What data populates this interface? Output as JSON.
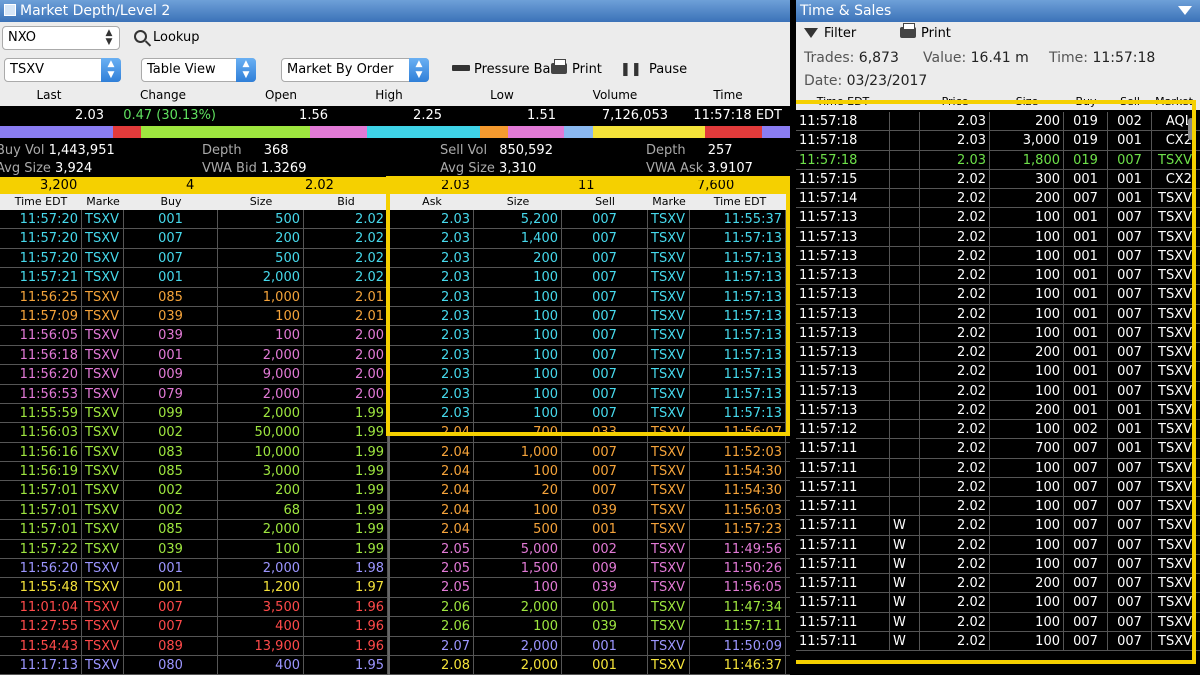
{
  "left_window": {
    "title": "Market Depth/Level 2",
    "symbol_value": "NXO",
    "lookup_label": "Lookup",
    "exchange_value": "TSXV",
    "view_value": "Table View",
    "mode_value": "Market By Order",
    "pressure_bar_label": "Pressure Bar",
    "print_label": "Print",
    "pause_label": "Pause"
  },
  "quote": {
    "headers": [
      "Last",
      "Change",
      "Open",
      "High",
      "Low",
      "Volume",
      "Time"
    ],
    "last": "2.03",
    "change": "0.47 (30.13%)",
    "open": "1.56",
    "high": "2.25",
    "low": "1.51",
    "volume": "7,126,053",
    "time": "11:57:18 EDT"
  },
  "color_strip": [
    "#8a7df2",
    "#8a7df2",
    "#8a7df2",
    "#8a7df2",
    "#e23b3b",
    "#9ee63f",
    "#9ee63f",
    "#9ee63f",
    "#9ee63f",
    "#9ee63f",
    "#9ee63f",
    "#e27ad6",
    "#e27ad6",
    "#3fd3e8",
    "#3fd3e8",
    "#3fd3e8",
    "#3fd3e8",
    "#f59a2f",
    "#e27ad6",
    "#e27ad6",
    "#8ab8f0",
    "#f5e33a",
    "#f5e33a",
    "#f5e33a",
    "#f5e33a",
    "#e23b3b",
    "#e23b3b",
    "#8a7df2"
  ],
  "stats": {
    "buy_vol_label": "Buy Vol",
    "buy_vol": "1,443,951",
    "avg_size_label": "Avg Size",
    "avg_size_bid": "3,924",
    "depth_label": "Depth",
    "depth_bid": "368",
    "vwa_bid_label": "VWA Bid",
    "vwa_bid": "1.3269",
    "sell_vol_label": "Sell Vol",
    "sell_vol": "850,592",
    "avg_size_ask": "3,310",
    "depth_ask": "257",
    "vwa_ask_label": "VWA Ask",
    "vwa_ask": "3.9107"
  },
  "summary": {
    "bid_size": "3,200",
    "bid_count": "4",
    "bid_price": "2.02",
    "ask_price": "2.03",
    "ask_count": "11",
    "ask_size": "7,600"
  },
  "bid_headers": [
    "Time EDT",
    "Marke",
    "Buy",
    "Size",
    "Bid"
  ],
  "ask_headers": [
    "Ask",
    "Size",
    "Sell",
    "Marke",
    "Time EDT"
  ],
  "bids": [
    {
      "time": "11:57:20",
      "mkt": "TSXV",
      "broker": "001",
      "size": "500",
      "price": "2.02",
      "color": "#46d9ec"
    },
    {
      "time": "11:57:20",
      "mkt": "TSXV",
      "broker": "007",
      "size": "200",
      "price": "2.02",
      "color": "#46d9ec"
    },
    {
      "time": "11:57:20",
      "mkt": "TSXV",
      "broker": "007",
      "size": "500",
      "price": "2.02",
      "color": "#46d9ec"
    },
    {
      "time": "11:57:21",
      "mkt": "TSXV",
      "broker": "001",
      "size": "2,000",
      "price": "2.02",
      "color": "#46d9ec"
    },
    {
      "time": "11:56:25",
      "mkt": "TSXV",
      "broker": "085",
      "size": "1,000",
      "price": "2.01",
      "color": "#f5a33a"
    },
    {
      "time": "11:57:09",
      "mkt": "TSXV",
      "broker": "039",
      "size": "100",
      "price": "2.01",
      "color": "#f5a33a"
    },
    {
      "time": "11:56:05",
      "mkt": "TSXV",
      "broker": "039",
      "size": "100",
      "price": "2.00",
      "color": "#e27ad6"
    },
    {
      "time": "11:56:18",
      "mkt": "TSXV",
      "broker": "001",
      "size": "2,000",
      "price": "2.00",
      "color": "#e27ad6"
    },
    {
      "time": "11:56:20",
      "mkt": "TSXV",
      "broker": "009",
      "size": "9,000",
      "price": "2.00",
      "color": "#e27ad6"
    },
    {
      "time": "11:56:53",
      "mkt": "TSXV",
      "broker": "079",
      "size": "2,000",
      "price": "2.00",
      "color": "#e27ad6"
    },
    {
      "time": "11:55:59",
      "mkt": "TSXV",
      "broker": "099",
      "size": "2,000",
      "price": "1.99",
      "color": "#9ee63f"
    },
    {
      "time": "11:56:03",
      "mkt": "TSXV",
      "broker": "002",
      "size": "50,000",
      "price": "1.99",
      "color": "#9ee63f"
    },
    {
      "time": "11:56:16",
      "mkt": "TSXV",
      "broker": "083",
      "size": "10,000",
      "price": "1.99",
      "color": "#9ee63f"
    },
    {
      "time": "11:56:19",
      "mkt": "TSXV",
      "broker": "085",
      "size": "3,000",
      "price": "1.99",
      "color": "#9ee63f"
    },
    {
      "time": "11:57:01",
      "mkt": "TSXV",
      "broker": "002",
      "size": "200",
      "price": "1.99",
      "color": "#9ee63f"
    },
    {
      "time": "11:57:01",
      "mkt": "TSXV",
      "broker": "002",
      "size": "68",
      "price": "1.99",
      "color": "#9ee63f"
    },
    {
      "time": "11:57:01",
      "mkt": "TSXV",
      "broker": "085",
      "size": "2,000",
      "price": "1.99",
      "color": "#9ee63f"
    },
    {
      "time": "11:57:22",
      "mkt": "TSXV",
      "broker": "039",
      "size": "100",
      "price": "1.99",
      "color": "#9ee63f"
    },
    {
      "time": "11:56:20",
      "mkt": "TSXV",
      "broker": "001",
      "size": "2,000",
      "price": "1.98",
      "color": "#9c96ff"
    },
    {
      "time": "11:55:48",
      "mkt": "TSXV",
      "broker": "001",
      "size": "1,200",
      "price": "1.97",
      "color": "#f5e33a"
    },
    {
      "time": "11:01:04",
      "mkt": "TSXV",
      "broker": "007",
      "size": "3,500",
      "price": "1.96",
      "color": "#ff4a4a"
    },
    {
      "time": "11:27:55",
      "mkt": "TSXV",
      "broker": "007",
      "size": "400",
      "price": "1.96",
      "color": "#ff4a4a"
    },
    {
      "time": "11:54:43",
      "mkt": "TSXV",
      "broker": "089",
      "size": "13,900",
      "price": "1.96",
      "color": "#ff4a4a"
    },
    {
      "time": "11:17:13",
      "mkt": "TSXV",
      "broker": "080",
      "size": "400",
      "price": "1.95",
      "color": "#9c96ff"
    }
  ],
  "asks": [
    {
      "price": "2.03",
      "size": "5,200",
      "broker": "007",
      "mkt": "TSXV",
      "time": "11:55:37",
      "color": "#46d9ec"
    },
    {
      "price": "2.03",
      "size": "1,400",
      "broker": "007",
      "mkt": "TSXV",
      "time": "11:57:13",
      "color": "#46d9ec"
    },
    {
      "price": "2.03",
      "size": "200",
      "broker": "007",
      "mkt": "TSXV",
      "time": "11:57:13",
      "color": "#46d9ec"
    },
    {
      "price": "2.03",
      "size": "100",
      "broker": "007",
      "mkt": "TSXV",
      "time": "11:57:13",
      "color": "#46d9ec"
    },
    {
      "price": "2.03",
      "size": "100",
      "broker": "007",
      "mkt": "TSXV",
      "time": "11:57:13",
      "color": "#46d9ec"
    },
    {
      "price": "2.03",
      "size": "100",
      "broker": "007",
      "mkt": "TSXV",
      "time": "11:57:13",
      "color": "#46d9ec"
    },
    {
      "price": "2.03",
      "size": "100",
      "broker": "007",
      "mkt": "TSXV",
      "time": "11:57:13",
      "color": "#46d9ec"
    },
    {
      "price": "2.03",
      "size": "100",
      "broker": "007",
      "mkt": "TSXV",
      "time": "11:57:13",
      "color": "#46d9ec"
    },
    {
      "price": "2.03",
      "size": "100",
      "broker": "007",
      "mkt": "TSXV",
      "time": "11:57:13",
      "color": "#46d9ec"
    },
    {
      "price": "2.03",
      "size": "100",
      "broker": "007",
      "mkt": "TSXV",
      "time": "11:57:13",
      "color": "#46d9ec"
    },
    {
      "price": "2.03",
      "size": "100",
      "broker": "007",
      "mkt": "TSXV",
      "time": "11:57:13",
      "color": "#46d9ec"
    },
    {
      "price": "2.04",
      "size": "700",
      "broker": "033",
      "mkt": "TSXV",
      "time": "11:56:07",
      "color": "#f5a33a"
    },
    {
      "price": "2.04",
      "size": "1,000",
      "broker": "007",
      "mkt": "TSXV",
      "time": "11:52:03",
      "color": "#f5a33a"
    },
    {
      "price": "2.04",
      "size": "100",
      "broker": "007",
      "mkt": "TSXV",
      "time": "11:54:30",
      "color": "#f5a33a"
    },
    {
      "price": "2.04",
      "size": "20",
      "broker": "007",
      "mkt": "TSXV",
      "time": "11:54:30",
      "color": "#f5a33a"
    },
    {
      "price": "2.04",
      "size": "100",
      "broker": "039",
      "mkt": "TSXV",
      "time": "11:56:03",
      "color": "#f5a33a"
    },
    {
      "price": "2.04",
      "size": "500",
      "broker": "001",
      "mkt": "TSXV",
      "time": "11:57:23",
      "color": "#f5a33a"
    },
    {
      "price": "2.05",
      "size": "5,000",
      "broker": "002",
      "mkt": "TSXV",
      "time": "11:49:56",
      "color": "#e27ad6"
    },
    {
      "price": "2.05",
      "size": "1,500",
      "broker": "009",
      "mkt": "TSXV",
      "time": "11:50:26",
      "color": "#e27ad6"
    },
    {
      "price": "2.05",
      "size": "100",
      "broker": "039",
      "mkt": "TSXV",
      "time": "11:56:05",
      "color": "#e27ad6"
    },
    {
      "price": "2.06",
      "size": "2,000",
      "broker": "001",
      "mkt": "TSXV",
      "time": "11:47:34",
      "color": "#9ee63f"
    },
    {
      "price": "2.06",
      "size": "100",
      "broker": "039",
      "mkt": "TSXV",
      "time": "11:57:11",
      "color": "#9ee63f"
    },
    {
      "price": "2.07",
      "size": "2,000",
      "broker": "001",
      "mkt": "TSXV",
      "time": "11:50:09",
      "color": "#9c96ff"
    },
    {
      "price": "2.08",
      "size": "2,000",
      "broker": "001",
      "mkt": "TSXV",
      "time": "11:46:37",
      "color": "#f5e33a"
    }
  ],
  "right_window": {
    "title": "Time & Sales",
    "filter_label": "Filter",
    "print_label": "Print",
    "trades_label": "Trades:",
    "trades_value": "6,873",
    "value_label": "Value:",
    "value_value": "16.41 m",
    "time_label": "Time:",
    "time_value": "11:57:18",
    "date_label": "Date:",
    "date_value": "03/23/2017",
    "headers": [
      "Time EDT",
      "",
      "Price",
      "Size",
      "Buy",
      "Sell",
      "Market"
    ]
  },
  "trades": [
    {
      "time": "11:57:18",
      "flag": "",
      "price": "2.03",
      "size": "200",
      "buy": "019",
      "sell": "002",
      "mkt": "AQL",
      "color": "#ffffff"
    },
    {
      "time": "11:57:18",
      "flag": "",
      "price": "2.03",
      "size": "3,000",
      "buy": "019",
      "sell": "001",
      "mkt": "CX2",
      "color": "#ffffff"
    },
    {
      "time": "11:57:18",
      "flag": "",
      "price": "2.03",
      "size": "1,800",
      "buy": "019",
      "sell": "007",
      "mkt": "TSXV",
      "color": "#6ee04a"
    },
    {
      "time": "11:57:15",
      "flag": "",
      "price": "2.02",
      "size": "300",
      "buy": "001",
      "sell": "001",
      "mkt": "CX2",
      "color": "#ffffff"
    },
    {
      "time": "11:57:14",
      "flag": "",
      "price": "2.02",
      "size": "200",
      "buy": "007",
      "sell": "001",
      "mkt": "TSXV",
      "color": "#ffffff"
    },
    {
      "time": "11:57:13",
      "flag": "",
      "price": "2.02",
      "size": "100",
      "buy": "001",
      "sell": "007",
      "mkt": "TSXV",
      "color": "#ffffff"
    },
    {
      "time": "11:57:13",
      "flag": "",
      "price": "2.02",
      "size": "100",
      "buy": "001",
      "sell": "007",
      "mkt": "TSXV",
      "color": "#ffffff"
    },
    {
      "time": "11:57:13",
      "flag": "",
      "price": "2.02",
      "size": "100",
      "buy": "001",
      "sell": "007",
      "mkt": "TSXV",
      "color": "#ffffff"
    },
    {
      "time": "11:57:13",
      "flag": "",
      "price": "2.02",
      "size": "100",
      "buy": "001",
      "sell": "007",
      "mkt": "TSXV",
      "color": "#ffffff"
    },
    {
      "time": "11:57:13",
      "flag": "",
      "price": "2.02",
      "size": "100",
      "buy": "001",
      "sell": "007",
      "mkt": "TSXV",
      "color": "#ffffff"
    },
    {
      "time": "11:57:13",
      "flag": "",
      "price": "2.02",
      "size": "100",
      "buy": "001",
      "sell": "007",
      "mkt": "TSXV",
      "color": "#ffffff"
    },
    {
      "time": "11:57:13",
      "flag": "",
      "price": "2.02",
      "size": "100",
      "buy": "001",
      "sell": "007",
      "mkt": "TSXV",
      "color": "#ffffff"
    },
    {
      "time": "11:57:13",
      "flag": "",
      "price": "2.02",
      "size": "200",
      "buy": "001",
      "sell": "007",
      "mkt": "TSXV",
      "color": "#ffffff"
    },
    {
      "time": "11:57:13",
      "flag": "",
      "price": "2.02",
      "size": "100",
      "buy": "001",
      "sell": "007",
      "mkt": "TSXV",
      "color": "#ffffff"
    },
    {
      "time": "11:57:13",
      "flag": "",
      "price": "2.02",
      "size": "100",
      "buy": "001",
      "sell": "007",
      "mkt": "TSXV",
      "color": "#ffffff"
    },
    {
      "time": "11:57:13",
      "flag": "",
      "price": "2.02",
      "size": "200",
      "buy": "001",
      "sell": "001",
      "mkt": "TSXV",
      "color": "#ffffff"
    },
    {
      "time": "11:57:12",
      "flag": "",
      "price": "2.02",
      "size": "100",
      "buy": "002",
      "sell": "001",
      "mkt": "TSXV",
      "color": "#ffffff"
    },
    {
      "time": "11:57:11",
      "flag": "",
      "price": "2.02",
      "size": "700",
      "buy": "007",
      "sell": "001",
      "mkt": "TSXV",
      "color": "#ffffff"
    },
    {
      "time": "11:57:11",
      "flag": "",
      "price": "2.02",
      "size": "100",
      "buy": "007",
      "sell": "007",
      "mkt": "TSXV",
      "color": "#ffffff"
    },
    {
      "time": "11:57:11",
      "flag": "",
      "price": "2.02",
      "size": "100",
      "buy": "007",
      "sell": "007",
      "mkt": "TSXV",
      "color": "#ffffff"
    },
    {
      "time": "11:57:11",
      "flag": "",
      "price": "2.02",
      "size": "100",
      "buy": "007",
      "sell": "007",
      "mkt": "TSXV",
      "color": "#ffffff"
    },
    {
      "time": "11:57:11",
      "flag": "W",
      "price": "2.02",
      "size": "100",
      "buy": "007",
      "sell": "007",
      "mkt": "TSXV",
      "color": "#ffffff"
    },
    {
      "time": "11:57:11",
      "flag": "W",
      "price": "2.02",
      "size": "100",
      "buy": "007",
      "sell": "007",
      "mkt": "TSXV",
      "color": "#ffffff"
    },
    {
      "time": "11:57:11",
      "flag": "W",
      "price": "2.02",
      "size": "100",
      "buy": "007",
      "sell": "007",
      "mkt": "TSXV",
      "color": "#ffffff"
    },
    {
      "time": "11:57:11",
      "flag": "W",
      "price": "2.02",
      "size": "200",
      "buy": "007",
      "sell": "007",
      "mkt": "TSXV",
      "color": "#ffffff"
    },
    {
      "time": "11:57:11",
      "flag": "W",
      "price": "2.02",
      "size": "100",
      "buy": "007",
      "sell": "007",
      "mkt": "TSXV",
      "color": "#ffffff"
    },
    {
      "time": "11:57:11",
      "flag": "W",
      "price": "2.02",
      "size": "100",
      "buy": "007",
      "sell": "007",
      "mkt": "TSXV",
      "color": "#ffffff"
    },
    {
      "time": "11:57:11",
      "flag": "W",
      "price": "2.02",
      "size": "100",
      "buy": "007",
      "sell": "007",
      "mkt": "TSXV",
      "color": "#ffffff"
    }
  ]
}
